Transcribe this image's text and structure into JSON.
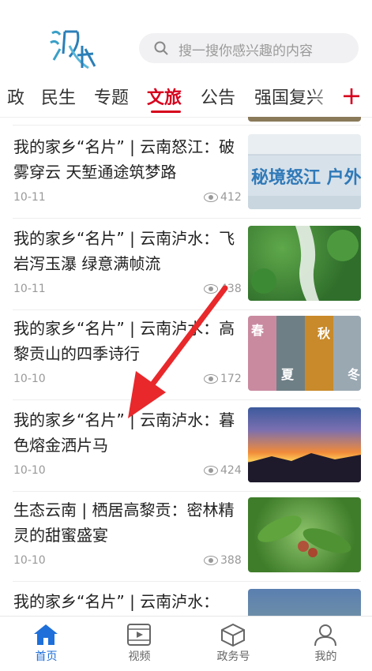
{
  "header": {
    "logo_text": "泸水",
    "search_placeholder": "搜一搜你感兴趣的内容"
  },
  "tabs": [
    {
      "label": "政"
    },
    {
      "label": "民生"
    },
    {
      "label": "专题"
    },
    {
      "label": "文旅"
    },
    {
      "label": "公告"
    },
    {
      "label": "强国复兴"
    }
  ],
  "tabs_add": "+",
  "articles": [
    {
      "title": "我的家乡“名片” | 云南怒江：破雾穿云 天堑通途筑梦路",
      "date": "10-11",
      "views": "412",
      "thumb_text": "秘境怒江 户外天"
    },
    {
      "title": "我的家乡“名片” | 云南泸水：飞岩泻玉瀑 绿意满帧流",
      "date": "10-11",
      "views": "438"
    },
    {
      "title": "我的家乡“名片” | 云南泸水：高黎贡山的四季诗行",
      "date": "10-10",
      "views": "172",
      "seasons": [
        "春",
        "夏",
        "秋",
        "冬"
      ]
    },
    {
      "title": "我的家乡“名片” | 云南泸水：暮色熔金洒片马",
      "date": "10-10",
      "views": "424"
    },
    {
      "title": "生态云南 | 栖居高黎贡：密林精灵的甜蜜盛宴",
      "date": "10-10",
      "views": "388"
    },
    {
      "title": "我的家乡“名片” | 云南泸水："
    }
  ],
  "bottom_nav": [
    {
      "label": "首页",
      "icon": "home-icon",
      "active": true
    },
    {
      "label": "视频",
      "icon": "video-icon"
    },
    {
      "label": "政务号",
      "icon": "cube-icon"
    },
    {
      "label": "我的",
      "icon": "user-icon"
    }
  ],
  "colors": {
    "accent": "#d6001c",
    "nav_active": "#1e6fd9"
  }
}
